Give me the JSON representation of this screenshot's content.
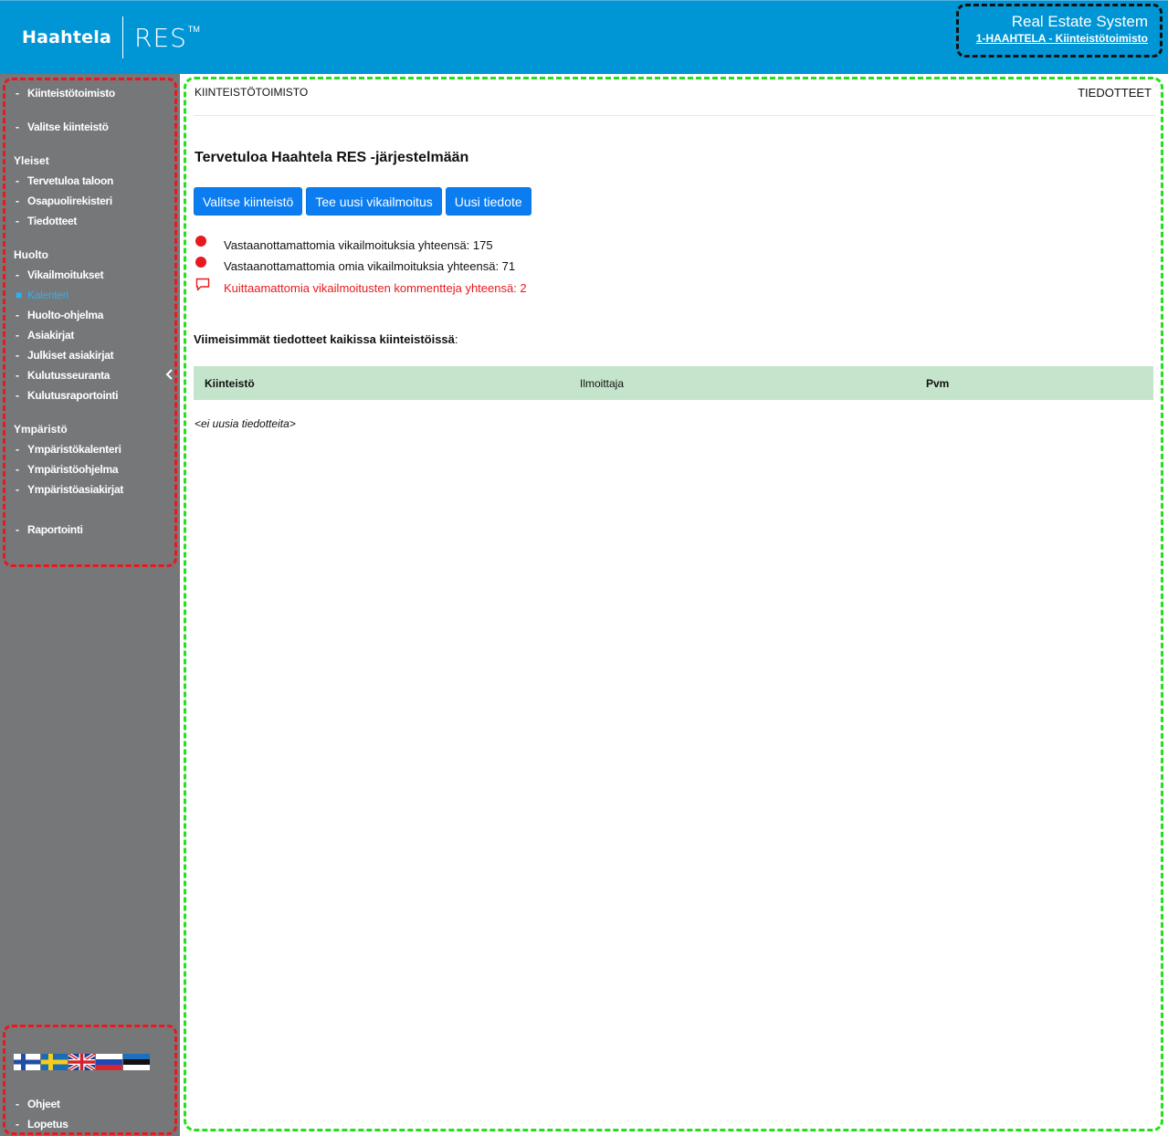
{
  "header": {
    "logo_name": "Haahtela",
    "logo_product": "RES",
    "logo_tm": "TM",
    "app_title": "Real Estate System",
    "org_link": "1-HAAHTELA - Kiinteistötoimisto",
    "background": "#0096d6"
  },
  "sidebar": {
    "background": "#757779",
    "top_items": [
      {
        "label": "Kiinteistötoimisto"
      },
      {
        "label": "Valitse kiinteistö"
      }
    ],
    "sections": [
      {
        "heading": "Yleiset",
        "items": [
          "Tervetuloa taloon",
          "Osapuolirekisteri",
          "Tiedotteet"
        ]
      },
      {
        "heading": "Huolto",
        "items": [
          "Vikailmoitukset",
          "Kalenteri",
          "Huolto-ohjelma",
          "Asiakirjat",
          "Julkiset asiakirjat",
          "Kulutusseuranta",
          "Kulutusraportointi"
        ]
      },
      {
        "heading": "Ympäristö",
        "items": [
          "Ympäristökalenteri",
          "Ympäristöohjelma",
          "Ympäristöasiakirjat"
        ]
      }
    ],
    "active_item": "Kalenteri",
    "reporting": "Raportointi",
    "languages": [
      "Suomi",
      "Svenska",
      "English",
      "Русский",
      "Eesti"
    ],
    "help": "Ohjeet",
    "logout": "Lopetus",
    "dash": "-",
    "active_color": "#2bb2f2"
  },
  "main": {
    "breadcrumb": "KIINTEISTÖTOIMISTO",
    "section_name": "TIEDOTTEET",
    "welcome": "Tervetuloa Haahtela RES -järjestelmään",
    "buttons": [
      "Valitse kiinteistö",
      "Tee uusi vikailmoitus",
      "Uusi tiedote"
    ],
    "button_color": "#0b7df1",
    "stats": [
      {
        "text": "Vastaanottamattomia vikailmoituksia yhteensä: 175",
        "icon": "red-dot-icon"
      },
      {
        "text": "Vastaanottamattomia omia vikailmoituksia yhteensä: 71",
        "icon": "red-dot-icon"
      },
      {
        "text": "Kuittaamattomia vikailmoitusten kommentteja yhteensä: 2",
        "icon": "comment-icon"
      }
    ],
    "latest_heading": "Viimeisimmät tiedotteet kaikissa kiinteistöissä",
    "latest_colon": ":",
    "table": {
      "columns": [
        "Kiinteistö",
        "Ilmoittaja",
        "Pvm"
      ],
      "header_color": "#c4e5cb",
      "empty_text": "<ei uusia tiedotteita>"
    }
  }
}
